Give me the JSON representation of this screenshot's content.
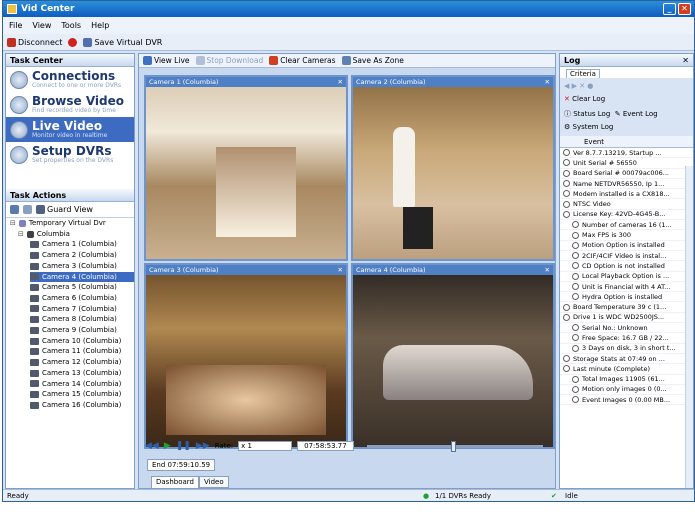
{
  "window": {
    "title": "Vid Center"
  },
  "menu": [
    "File",
    "View",
    "Tools",
    "Help"
  ],
  "toolbar": {
    "disconnect": "Disconnect",
    "save_virtual": "Save Virtual DVR"
  },
  "task_center": {
    "title": "Task Center",
    "tasks": [
      {
        "label": "Connections",
        "sub": "Connect to one or more DVRs"
      },
      {
        "label": "Browse Video",
        "sub": "Find recorded video by time"
      },
      {
        "label": "Live Video",
        "sub": "Monitor video in realtime"
      },
      {
        "label": "Setup DVRs",
        "sub": "Set properties on the DVRs"
      }
    ]
  },
  "task_actions": {
    "title": "Task Actions",
    "guard_view": "Guard View",
    "tree_root": "Temporary Virtual Dvr",
    "tree_site": "Columbia",
    "cameras": [
      "Camera 1 (Columbia)",
      "Camera 2 (Columbia)",
      "Camera 3 (Columbia)",
      "Camera 4 (Columbia)",
      "Camera 5 (Columbia)",
      "Camera 6 (Columbia)",
      "Camera 7 (Columbia)",
      "Camera 8 (Columbia)",
      "Camera 9 (Columbia)",
      "Camera 10 (Columbia)",
      "Camera 11 (Columbia)",
      "Camera 12 (Columbia)",
      "Camera 13 (Columbia)",
      "Camera 14 (Columbia)",
      "Camera 15 (Columbia)",
      "Camera 16 (Columbia)"
    ]
  },
  "center": {
    "tools": [
      "View Live",
      "Stop Download",
      "Clear Cameras",
      "Save As Zone"
    ],
    "videos": [
      "Camera 1 (Columbia)",
      "Camera 2 (Columbia)",
      "Camera 3 (Columbia)",
      "Camera 4 (Columbia)"
    ],
    "rate_label": "Rate:",
    "rate_value": "x 1",
    "time": "07:58:53.77",
    "end": "End 07:59:10.59",
    "tabs": [
      "Dashboard",
      "Video"
    ]
  },
  "log": {
    "title": "Log",
    "criteria": "Criteria",
    "clear": "Clear Log",
    "status_log": "Status Log",
    "event_log": "Event Log",
    "system_log": "System Log",
    "event_header": "Event",
    "rows": [
      "Ver 8.7.7.13219, Startup ...",
      "Unit Serial # 56550",
      "Board Serial # 00079ac006...",
      "Name NETDVR56550, Ip 1...",
      "Modem installed is a CX818...",
      "NTSC Video",
      "License Key: 42VD-4G45-B...",
      "Number of cameras 16 (1...",
      "Max FPS is 300",
      "Motion Option is installed",
      "2CIF/4CIF Video is instal...",
      "CD Option is not installed",
      "Local Playback Option is ...",
      "Unit is Financial with 4 AT...",
      "Hydra Option is installed",
      "Board Temperature 39 c (1...",
      "Drive 1 is WDC WD2500JS...",
      "Serial No.: Unknown",
      "Free Space: 16.7 GB / 22...",
      "3 Days on disk, 3 in short t...",
      "Storage Stats at 07:49 on ...",
      "Last minute (Complete)",
      "Total Images 11905 (61...",
      "Motion only images 0 (0...",
      "Event Images 0 (0.00 MB..."
    ]
  },
  "status": {
    "left": "Ready",
    "dvrs": "1/1 DVRs Ready",
    "right": "Idle"
  }
}
